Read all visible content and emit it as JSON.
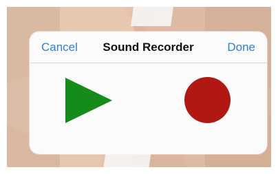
{
  "dialog": {
    "cancel_label": "Cancel",
    "title": "Sound Recorder",
    "done_label": "Done"
  },
  "controls": {
    "play_icon": "play-icon",
    "record_icon": "record-icon"
  },
  "colors": {
    "accent": "#2f7de1",
    "play": "#158c1a",
    "record": "#b21813",
    "dialog_background": "#fbfbfb",
    "title_text": "#111111"
  }
}
